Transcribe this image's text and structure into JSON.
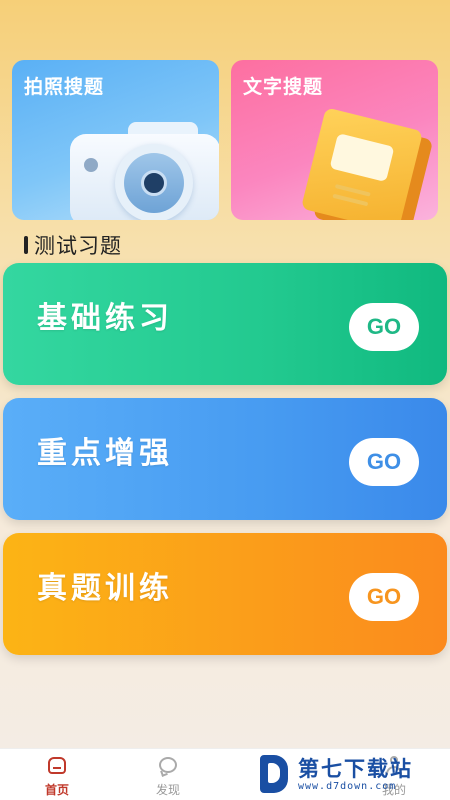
{
  "top_cards": [
    {
      "label": "拍照搜题",
      "icon": "camera-icon"
    },
    {
      "label": "文字搜题",
      "icon": "notebook-icon"
    }
  ],
  "section": {
    "title": "测试习题"
  },
  "practice_cards": [
    {
      "label": "基础练习",
      "button": "GO",
      "color": "#22c98f"
    },
    {
      "label": "重点增强",
      "button": "GO",
      "color": "#479bf1"
    },
    {
      "label": "真题训练",
      "button": "GO",
      "color": "#fb9e1a"
    }
  ],
  "tabbar": {
    "items": [
      {
        "label": "首页",
        "icon": "home-icon",
        "active": true
      },
      {
        "label": "发现",
        "icon": "chat-bubble-icon",
        "active": false
      },
      {
        "label": "我的",
        "icon": "person-icon",
        "active": false
      }
    ],
    "active_color": "#c0392b"
  },
  "watermark": {
    "name": "第七下载站",
    "url": "www.d7down.com"
  }
}
